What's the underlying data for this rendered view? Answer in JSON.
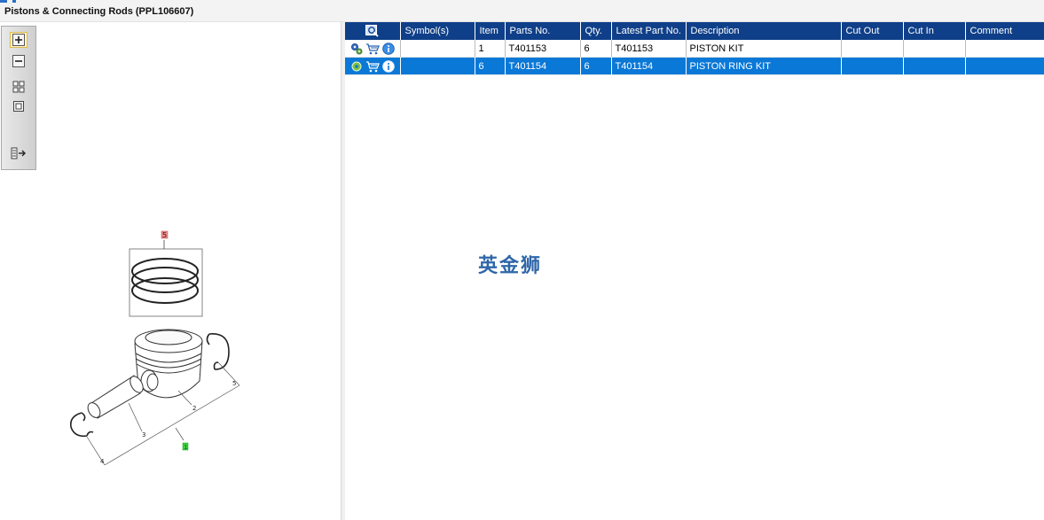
{
  "window": {
    "title": "Pistons & Connecting Rods (PPL106607)"
  },
  "toolbar": {
    "buttons": [
      {
        "name": "zoom-in",
        "icon": "zoom-in-icon"
      },
      {
        "name": "zoom-out",
        "icon": "zoom-out-icon"
      },
      {
        "name": "fit-all",
        "icon": "grid-icon"
      },
      {
        "name": "actual-size",
        "icon": "square-icon"
      },
      {
        "name": "show-list",
        "icon": "list-arrow-icon"
      }
    ]
  },
  "diagram": {
    "callouts": [
      "5",
      "2",
      "5",
      "3",
      "4",
      "1"
    ],
    "highlight_colors": {
      "selected": "#f08a8a",
      "current": "#3cd23c"
    }
  },
  "table": {
    "columns": [
      "Symbol(s)",
      "Item",
      "Parts No.",
      "Qty.",
      "Latest Part No.",
      "Description",
      "Cut Out",
      "Cut In",
      "Comment"
    ],
    "rows": [
      {
        "symbols": "",
        "item": "1",
        "part_no": "T401153",
        "qty": "6",
        "latest": "T401153",
        "desc": "PISTON KIT",
        "cut_out": "",
        "cut_in": "",
        "comment": "",
        "selected": false
      },
      {
        "symbols": "",
        "item": "6",
        "part_no": "T401154",
        "qty": "6",
        "latest": "T401154",
        "desc": "PISTON RING KIT",
        "cut_out": "",
        "cut_in": "",
        "comment": "",
        "selected": true
      }
    ]
  },
  "watermark": "英金狮",
  "colors": {
    "header_bg": "#0f3f88",
    "selected_row": "#0a78d7",
    "accent": "#2c6fc4"
  }
}
